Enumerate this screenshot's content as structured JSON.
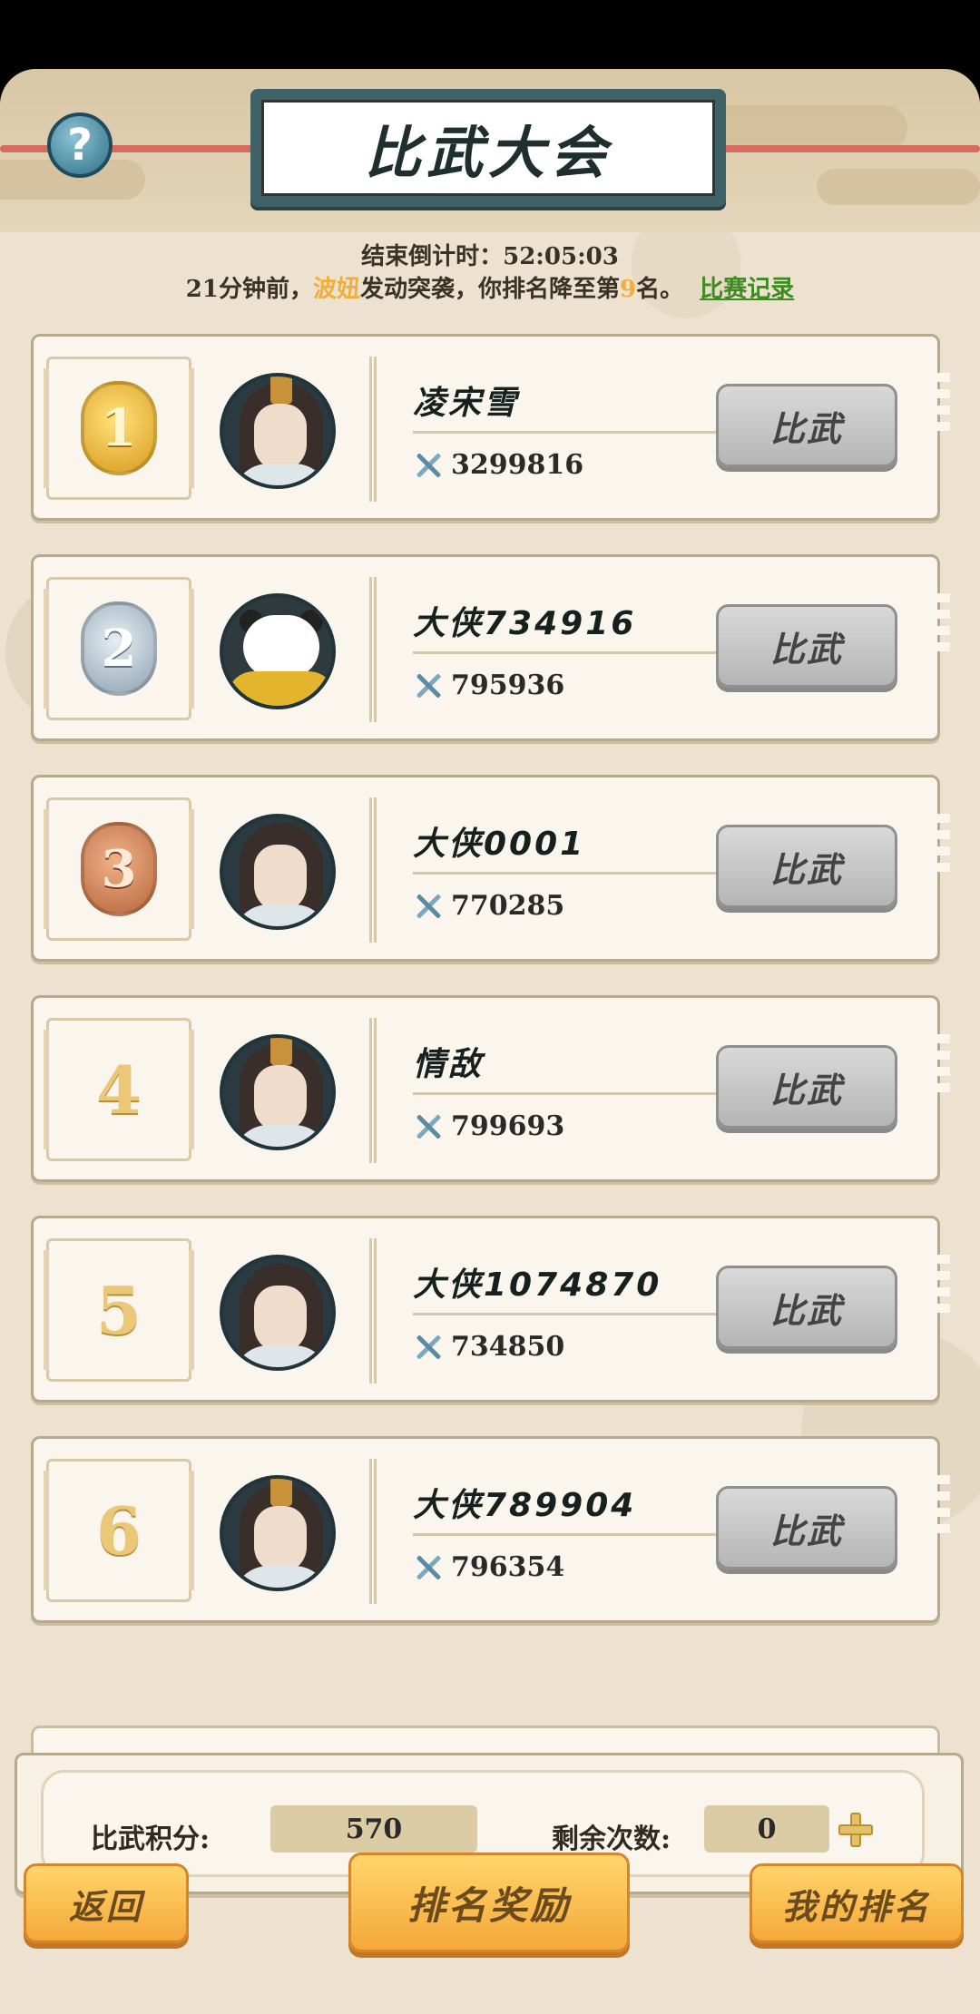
{
  "header": {
    "title": "比武大会",
    "help_icon": "question-mark-icon"
  },
  "countdown": {
    "label": "结束倒计时：",
    "value": "52:05:03"
  },
  "notice": {
    "prefix": "21分钟前，",
    "attacker": "波妞",
    "middle": "发动突袭，你排名降至第",
    "rank": "9",
    "suffix": "名。",
    "link": "比赛记录"
  },
  "rankings": [
    {
      "rank": "1",
      "medal": "gold",
      "name": "凌宋雪",
      "power": "3299816",
      "button": "比武",
      "avatar": "swordsman-hat"
    },
    {
      "rank": "2",
      "medal": "silver",
      "name": "大侠734916",
      "power": "795936",
      "button": "比武",
      "avatar": "panda"
    },
    {
      "rank": "3",
      "medal": "bronze",
      "name": "大侠0001",
      "power": "770285",
      "button": "比武",
      "avatar": "swordsman"
    },
    {
      "rank": "4",
      "medal": "",
      "name": "情敌",
      "power": "799693",
      "button": "比武",
      "avatar": "swordsman-hat"
    },
    {
      "rank": "5",
      "medal": "",
      "name": "大侠1074870",
      "power": "734850",
      "button": "比武",
      "avatar": "swordsman-bun"
    },
    {
      "rank": "6",
      "medal": "",
      "name": "大侠789904",
      "power": "796354",
      "button": "比武",
      "avatar": "swordswoman"
    }
  ],
  "stats": {
    "points_label": "比武积分:",
    "points_value": "570",
    "remaining_label": "剩余次数:",
    "remaining_value": "0"
  },
  "footer": {
    "back": "返回",
    "rewards": "排名奖励",
    "my_rank": "我的排名"
  },
  "colors": {
    "highlight": "#f0ae3c",
    "link": "#3e8b22",
    "button_orange": "#f5a83a",
    "button_gray": "#b5b5b5"
  }
}
